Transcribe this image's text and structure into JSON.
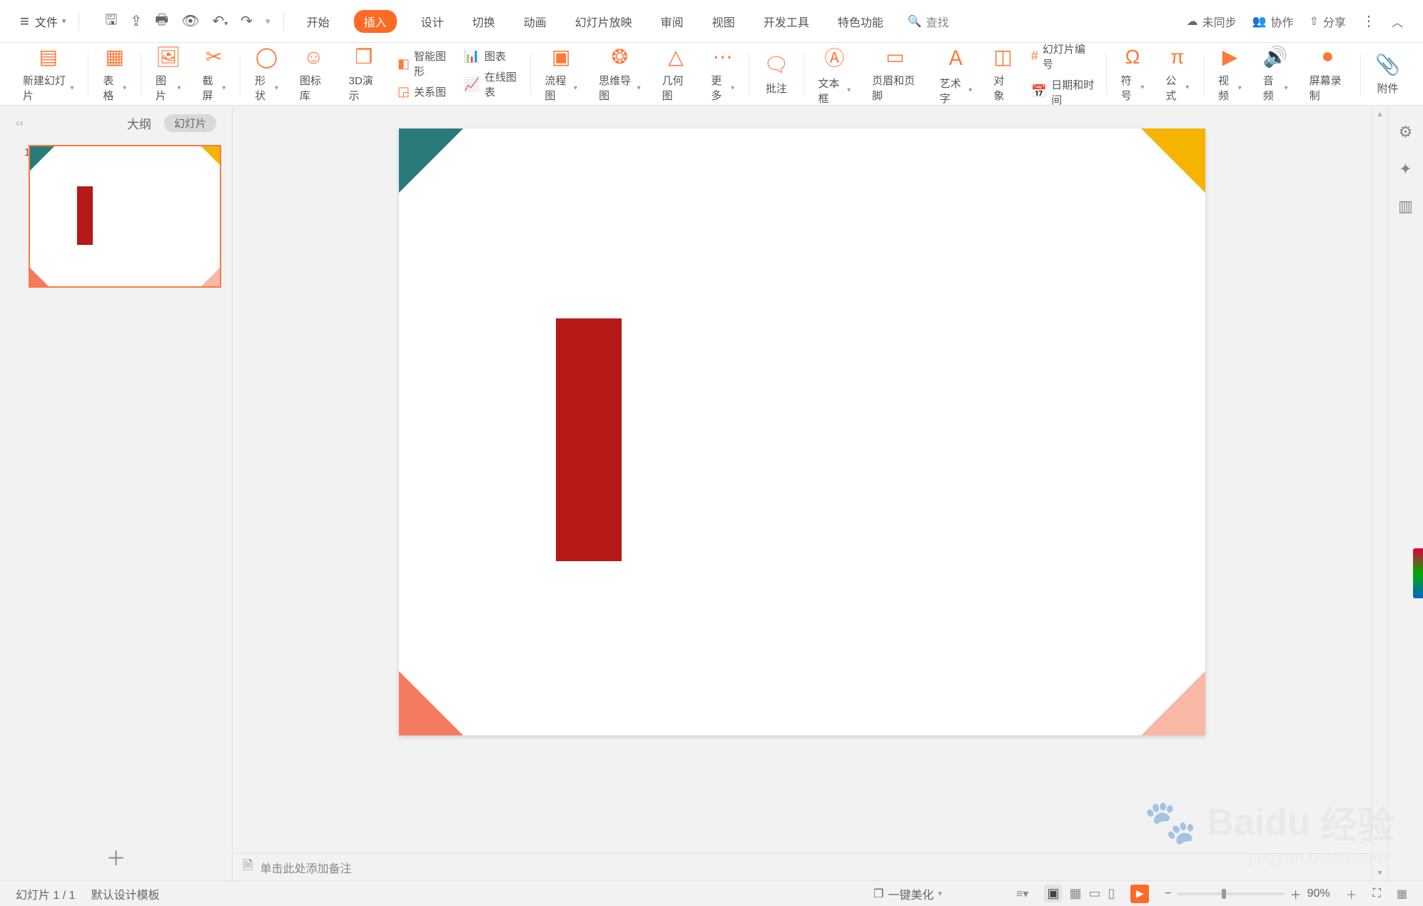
{
  "menu": {
    "file": "文件",
    "tabs": [
      "开始",
      "插入",
      "设计",
      "切换",
      "动画",
      "幻灯片放映",
      "审阅",
      "视图",
      "开发工具",
      "特色功能"
    ],
    "active_tab": 1,
    "search": "查找",
    "right": {
      "unsync": "未同步",
      "collab": "协作",
      "share": "分享"
    }
  },
  "ribbon": {
    "newslide": "新建幻灯片",
    "table": "表格",
    "picture": "图片",
    "screenshot": "截屏",
    "shape": "形状",
    "iconlib": "图标库",
    "threed": "3D演示",
    "smartart": "智能图形",
    "chart": "图表",
    "relation": "关系图",
    "onlinechart": "在线图表",
    "flowchart": "流程图",
    "mindmap": "思维导图",
    "geometry": "几何图",
    "more": "更多",
    "comment": "批注",
    "textbox": "文本框",
    "headerfooter": "页眉和页脚",
    "wordart": "艺术字",
    "object": "对象",
    "slidenum": "幻灯片编号",
    "datetime": "日期和时间",
    "symbol": "符号",
    "equation": "公式",
    "video": "视频",
    "audio": "音频",
    "screenrec": "屏幕录制",
    "attachment": "附件"
  },
  "sidepanel": {
    "collapse": "‹‹",
    "outline": "大纲",
    "slides": "幻灯片",
    "slide_num": "1",
    "add": "＋"
  },
  "notes": "单击此处添加备注",
  "status": {
    "slide": "幻灯片 1 / 1",
    "template": "默认设计模板",
    "beautify": "一键美化",
    "zoom": "90%",
    "fit": "⛶"
  },
  "watermark": {
    "brand": "Baidu",
    "cn": "经验",
    "url": "jingyan.baidu.com"
  }
}
